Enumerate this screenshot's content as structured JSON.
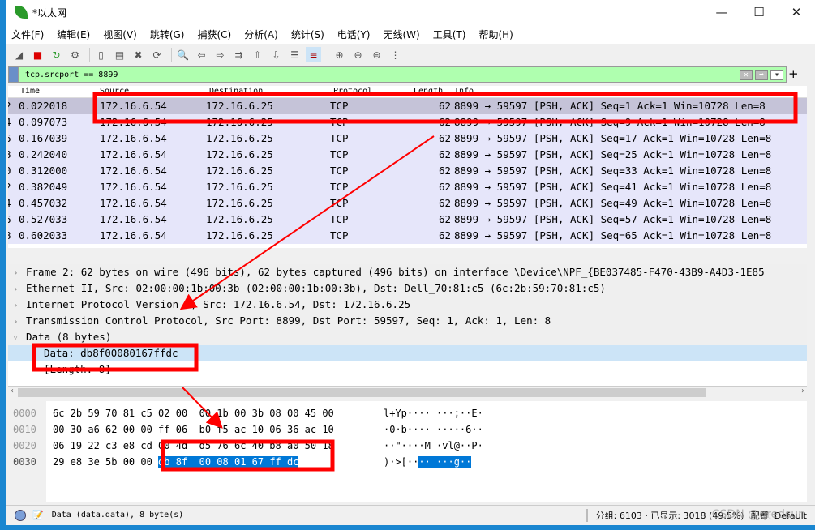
{
  "window": {
    "title": "*以太网",
    "min": "—",
    "max": "☐",
    "close": "✕"
  },
  "menu": [
    "文件(F)",
    "编辑(E)",
    "视图(V)",
    "跳转(G)",
    "捕获(C)",
    "分析(A)",
    "统计(S)",
    "电话(Y)",
    "无线(W)",
    "工具(T)",
    "帮助(H)"
  ],
  "toolbar": [
    "shark-fin-icon",
    "stop-icon",
    "restart-icon",
    "options-icon",
    "open-icon",
    "save-icon",
    "close-file-icon",
    "reload-icon",
    "find-icon",
    "back-icon",
    "forward-icon",
    "goto-icon",
    "first-icon",
    "last-icon",
    "autoscroll-icon",
    "colorize-icon",
    "zoom-in-icon",
    "zoom-out-icon",
    "zoom-normal-icon",
    "resize-columns-icon"
  ],
  "filter": {
    "value": "tcp.srcport == 8899",
    "clear": "✕",
    "apply": "➡",
    "dropdown": "▾",
    "add": "+"
  },
  "columns": [
    "Time",
    "Source",
    "Destination",
    "Protocol",
    "Length",
    "Info"
  ],
  "packets": [
    {
      "no": "2",
      "time": "0.022018",
      "src": "172.16.6.54",
      "dst": "172.16.6.25",
      "proto": "TCP",
      "len": "62",
      "info": "8899 → 59597 [PSH, ACK] Seq=1 Ack=1 Win=10728 Len=8"
    },
    {
      "no": "4",
      "time": "0.097073",
      "src": "172.16.6.54",
      "dst": "172.16.6.25",
      "proto": "TCP",
      "len": "62",
      "info": "8899 → 59597 [PSH, ACK] Seq=9 Ack=1 Win=10728 Len=8"
    },
    {
      "no": "6",
      "time": "0.167039",
      "src": "172.16.6.54",
      "dst": "172.16.6.25",
      "proto": "TCP",
      "len": "62",
      "info": "8899 → 59597 [PSH, ACK] Seq=17 Ack=1 Win=10728 Len=8"
    },
    {
      "no": "8",
      "time": "0.242040",
      "src": "172.16.6.54",
      "dst": "172.16.6.25",
      "proto": "TCP",
      "len": "62",
      "info": "8899 → 59597 [PSH, ACK] Seq=25 Ack=1 Win=10728 Len=8"
    },
    {
      "no": "0",
      "time": "0.312000",
      "src": "172.16.6.54",
      "dst": "172.16.6.25",
      "proto": "TCP",
      "len": "62",
      "info": "8899 → 59597 [PSH, ACK] Seq=33 Ack=1 Win=10728 Len=8"
    },
    {
      "no": "2",
      "time": "0.382049",
      "src": "172.16.6.54",
      "dst": "172.16.6.25",
      "proto": "TCP",
      "len": "62",
      "info": "8899 → 59597 [PSH, ACK] Seq=41 Ack=1 Win=10728 Len=8"
    },
    {
      "no": "4",
      "time": "0.457032",
      "src": "172.16.6.54",
      "dst": "172.16.6.25",
      "proto": "TCP",
      "len": "62",
      "info": "8899 → 59597 [PSH, ACK] Seq=49 Ack=1 Win=10728 Len=8"
    },
    {
      "no": "6",
      "time": "0.527033",
      "src": "172.16.6.54",
      "dst": "172.16.6.25",
      "proto": "TCP",
      "len": "62",
      "info": "8899 → 59597 [PSH, ACK] Seq=57 Ack=1 Win=10728 Len=8"
    },
    {
      "no": "8",
      "time": "0.602033",
      "src": "172.16.6.54",
      "dst": "172.16.6.25",
      "proto": "TCP",
      "len": "62",
      "info": "8899 → 59597 [PSH, ACK] Seq=65 Ack=1 Win=10728 Len=8"
    }
  ],
  "details": [
    {
      "arrow": "›",
      "text": "Frame 2: 62 bytes on wire (496 bits), 62 bytes captured (496 bits) on interface \\Device\\NPF_{BE037485-F470-43B9-A4D3-1E85"
    },
    {
      "arrow": "›",
      "text": "Ethernet II, Src: 02:00:00:1b:00:3b (02:00:00:1b:00:3b), Dst: Dell_70:81:c5 (6c:2b:59:70:81:c5)"
    },
    {
      "arrow": "›",
      "text": "Internet Protocol Version 4, Src: 172.16.6.54, Dst: 172.16.6.25"
    },
    {
      "arrow": "›",
      "text": "Transmission Control Protocol, Src Port: 8899, Dst Port: 59597, Seq: 1, Ack: 1, Len: 8"
    },
    {
      "arrow": "˅",
      "text": "Data (8 bytes)"
    }
  ],
  "data_field": "Data: db8f00080167ffdc",
  "length_field": "[Length: 8]",
  "hex": [
    {
      "off": "0000",
      "bytes": "6c 2b 59 70 81 c5 02 00  00 1b 00 3b 08 00 45 00",
      "ascii": "l+Yp···· ···;··E·"
    },
    {
      "off": "0010",
      "bytes": "00 30 a6 62 00 00 ff 06  b0 f5 ac 10 06 36 ac 10",
      "ascii": "·0·b···· ·····6··"
    },
    {
      "off": "0020",
      "bytes": "06 19 22 c3 e8 cd 00 4d  d5 76 6c 40 b8 a0 50 18",
      "ascii": "··\"····M ·vl@··P·"
    },
    {
      "off": "0030",
      "bytes": "29 e8 3e 5b 00 00 ",
      "sel": "db 8f  00 08 01 67 ff dc",
      "ascii": ")·>[··",
      "ascii_sel": "·· ···g··"
    }
  ],
  "status": {
    "field": "Data (data.data), 8 byte(s)",
    "packets": "分组: 6103 · 已显示: 3018 (49.5%)",
    "profile": "配置: Default",
    "watermark": "CSDN @qredsun"
  },
  "colors": {
    "annotation": "#ff0000",
    "filter_ok": "#afffaf",
    "row": "#e6e6fa",
    "selected_row": "#c5c3d8"
  }
}
